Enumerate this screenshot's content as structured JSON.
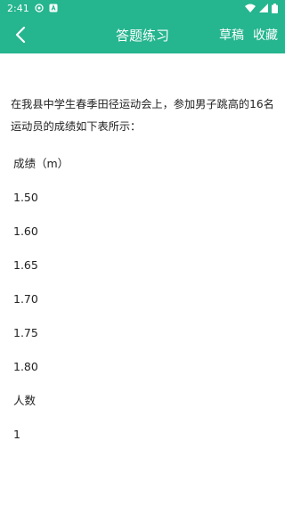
{
  "status_bar": {
    "time": "2:41"
  },
  "app_bar": {
    "title": "答题练习",
    "draft_label": "草稿",
    "favorite_label": "收藏"
  },
  "question": {
    "text": "在我县中学生春季田径运动会上，参加男子跳高的16名运动员的成绩如下表所示："
  },
  "table_rows": [
    "成绩（m）",
    "1.50",
    "1.60",
    "1.65",
    "1.70",
    "1.75",
    "1.80",
    "人数",
    "1"
  ],
  "colors": {
    "accent": "#25b58f"
  }
}
